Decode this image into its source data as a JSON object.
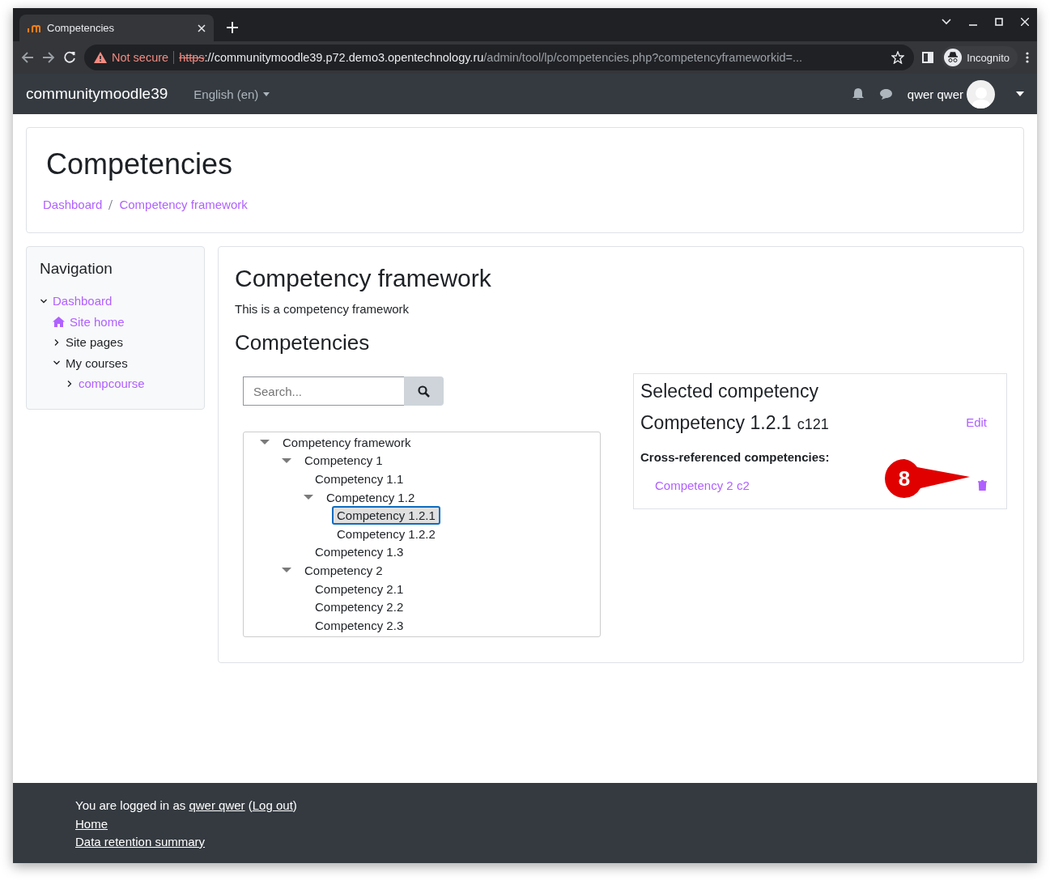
{
  "browser": {
    "tab_title": "Competencies",
    "url": {
      "warning": "Not secure",
      "scheme": "https",
      "host": "://communitymoodle39.p72.demo3.opentechnology.ru",
      "path": "/admin/tool/lp/competencies.php?competencyframeworkid=..."
    },
    "profile": "Incognito"
  },
  "navbar": {
    "brand": "communitymoodle39",
    "language": "English (en)",
    "user": "qwer qwer"
  },
  "header": {
    "title": "Competencies",
    "breadcrumbs": [
      "Dashboard",
      "Competency framework"
    ]
  },
  "navigation": {
    "title": "Navigation",
    "items": [
      {
        "label": "Dashboard",
        "kind": "link",
        "expanded": true,
        "children": [
          {
            "label": "Site home",
            "kind": "home"
          },
          {
            "label": "Site pages",
            "kind": "text",
            "expanded": false
          },
          {
            "label": "My courses",
            "kind": "text",
            "expanded": true,
            "children": [
              {
                "label": "compcourse",
                "kind": "link",
                "expanded": false
              }
            ]
          }
        ]
      }
    ]
  },
  "main": {
    "title": "Competency framework",
    "description": "This is a competency framework",
    "subtitle": "Competencies",
    "search": {
      "placeholder": "Search..."
    },
    "tree": [
      {
        "label": "Competency framework",
        "expanded": true,
        "selected": false,
        "children": [
          {
            "label": "Competency 1",
            "expanded": true,
            "selected": false,
            "children": [
              {
                "label": "Competency 1.1",
                "selected": false
              },
              {
                "label": "Competency 1.2",
                "expanded": true,
                "selected": false,
                "children": [
                  {
                    "label": "Competency 1.2.1",
                    "selected": true
                  },
                  {
                    "label": "Competency 1.2.2",
                    "selected": false
                  }
                ]
              },
              {
                "label": "Competency 1.3",
                "selected": false
              }
            ]
          },
          {
            "label": "Competency 2",
            "expanded": true,
            "selected": false,
            "children": [
              {
                "label": "Competency 2.1",
                "selected": false
              },
              {
                "label": "Competency 2.2",
                "selected": false
              },
              {
                "label": "Competency 2.3",
                "selected": false
              }
            ]
          }
        ]
      }
    ]
  },
  "selected_competency": {
    "title": "Selected competency",
    "name": "Competency 1.2.1",
    "idnumber": "c121",
    "edit": "Edit",
    "cross_label": "Cross-referenced competencies:",
    "cross_references": [
      "Competency 2 c2"
    ]
  },
  "callout": "8",
  "footer": {
    "logged_in": [
      {
        "kind": "text",
        "text": "You are logged in as "
      },
      {
        "kind": "link",
        "text": "qwer qwer"
      },
      {
        "kind": "text",
        "text": " ("
      },
      {
        "kind": "link",
        "text": "Log out"
      },
      {
        "kind": "text",
        "text": ")"
      }
    ],
    "links": [
      "Home",
      "Data retention summary"
    ]
  }
}
